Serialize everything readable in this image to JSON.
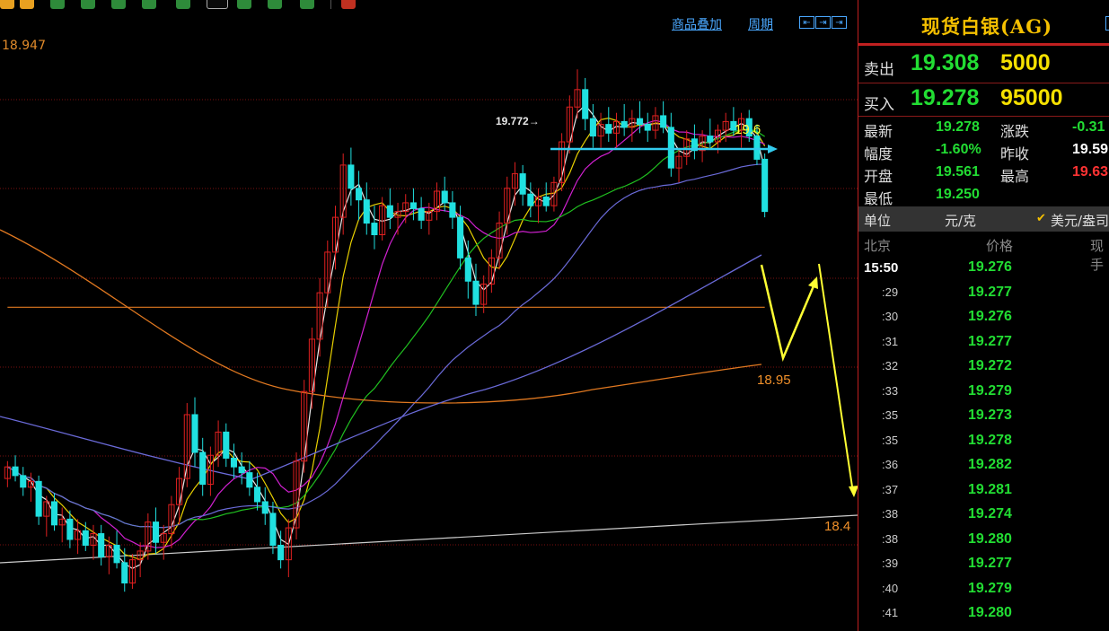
{
  "toolbar": {
    "buttons": [
      {
        "name": "tb-btn-1",
        "style": "orange"
      },
      {
        "name": "tb-btn-2",
        "style": "orange"
      },
      {
        "name": "tb-btn-3",
        "style": "green"
      },
      {
        "name": "tb-btn-4",
        "style": "green"
      },
      {
        "name": "tb-btn-5",
        "style": "green"
      },
      {
        "name": "tb-btn-6",
        "style": "green"
      },
      {
        "name": "tb-btn-7",
        "style": "green"
      },
      {
        "name": "tb-btn-8",
        "style": "sel"
      },
      {
        "name": "tb-btn-9",
        "style": "green"
      },
      {
        "name": "tb-btn-10",
        "style": "green"
      },
      {
        "name": "tb-btn-11",
        "style": "green"
      },
      {
        "name": "tb-btn-12",
        "style": "red"
      }
    ]
  },
  "chart": {
    "menu_overlay": "商品叠加",
    "menu_period": "周期",
    "top_price_label": "18.947",
    "colors": {
      "up": "#e02020",
      "down": "#20e0e0",
      "ma_white": "#e8e8e8",
      "ma_yellow": "#e8d000",
      "ma_magenta": "#d020d0",
      "ma_green": "#20c020",
      "ma_blue": "#6a6ad8",
      "ma_orange": "#e07820",
      "grid": "#7a1010",
      "annotation_yellow": "#ffff33",
      "annotation_cyan": "#33ccee",
      "trendline": "#cccccc",
      "label_orange": "#f0902a"
    }
  },
  "chart_data": {
    "type": "candlestick",
    "instrument": "AG",
    "y_unit": "元/克",
    "high_marker": 19.772,
    "candles_note": "approximate 1-minute candles read from chart",
    "ohlc": [
      [
        18.36,
        18.42,
        18.33,
        18.4
      ],
      [
        18.4,
        18.44,
        18.35,
        18.37
      ],
      [
        18.37,
        18.4,
        18.3,
        18.33
      ],
      [
        18.33,
        18.38,
        18.28,
        18.35
      ],
      [
        18.35,
        18.37,
        18.2,
        18.23
      ],
      [
        18.23,
        18.3,
        18.16,
        18.28
      ],
      [
        18.28,
        18.31,
        18.18,
        18.2
      ],
      [
        18.2,
        18.26,
        18.14,
        18.22
      ],
      [
        18.22,
        18.25,
        18.12,
        18.15
      ],
      [
        18.15,
        18.22,
        18.1,
        18.18
      ],
      [
        18.18,
        18.21,
        18.11,
        18.13
      ],
      [
        18.13,
        18.2,
        18.08,
        18.17
      ],
      [
        18.17,
        18.2,
        18.06,
        18.09
      ],
      [
        18.09,
        18.16,
        18.03,
        18.13
      ],
      [
        18.13,
        18.18,
        18.05,
        18.07
      ],
      [
        18.07,
        18.12,
        17.97,
        18.0
      ],
      [
        18.0,
        18.1,
        17.98,
        18.08
      ],
      [
        18.08,
        18.14,
        18.02,
        18.11
      ],
      [
        18.11,
        18.24,
        18.08,
        18.21
      ],
      [
        18.21,
        18.26,
        18.1,
        18.14
      ],
      [
        18.14,
        18.2,
        18.08,
        18.17
      ],
      [
        18.17,
        18.3,
        18.12,
        18.27
      ],
      [
        18.27,
        18.4,
        18.2,
        18.36
      ],
      [
        18.36,
        18.62,
        18.33,
        18.58
      ],
      [
        18.58,
        18.64,
        18.4,
        18.45
      ],
      [
        18.45,
        18.5,
        18.3,
        18.34
      ],
      [
        18.34,
        18.47,
        18.3,
        18.44
      ],
      [
        18.44,
        18.56,
        18.4,
        18.52
      ],
      [
        18.52,
        18.55,
        18.4,
        18.43
      ],
      [
        18.43,
        18.48,
        18.36,
        18.4
      ],
      [
        18.4,
        18.45,
        18.34,
        18.38
      ],
      [
        18.38,
        18.42,
        18.3,
        18.33
      ],
      [
        18.33,
        18.38,
        18.25,
        18.28
      ],
      [
        18.28,
        18.33,
        18.2,
        18.24
      ],
      [
        18.24,
        18.28,
        18.1,
        18.13
      ],
      [
        18.13,
        18.18,
        18.05,
        18.08
      ],
      [
        18.08,
        18.22,
        18.02,
        18.19
      ],
      [
        18.19,
        18.45,
        18.15,
        18.42
      ],
      [
        18.42,
        18.7,
        18.38,
        18.66
      ],
      [
        18.66,
        18.88,
        18.6,
        18.84
      ],
      [
        18.84,
        19.05,
        18.78,
        19.0
      ],
      [
        19.0,
        19.18,
        18.95,
        19.14
      ],
      [
        19.14,
        19.3,
        19.08,
        19.26
      ],
      [
        19.26,
        19.48,
        19.2,
        19.44
      ],
      [
        19.44,
        19.5,
        19.3,
        19.36
      ],
      [
        19.36,
        19.42,
        19.25,
        19.32
      ],
      [
        19.32,
        19.38,
        19.2,
        19.24
      ],
      [
        19.24,
        19.3,
        19.15,
        19.2
      ],
      [
        19.2,
        19.33,
        19.18,
        19.3
      ],
      [
        19.3,
        19.36,
        19.22,
        19.26
      ],
      [
        19.26,
        19.31,
        19.2,
        19.28
      ],
      [
        19.28,
        19.34,
        19.24,
        19.31
      ],
      [
        19.31,
        19.36,
        19.25,
        19.29
      ],
      [
        19.29,
        19.33,
        19.22,
        19.25
      ],
      [
        19.25,
        19.31,
        19.2,
        19.28
      ],
      [
        19.28,
        19.38,
        19.25,
        19.35
      ],
      [
        19.35,
        19.4,
        19.28,
        19.31
      ],
      [
        19.31,
        19.35,
        19.22,
        19.26
      ],
      [
        19.26,
        19.3,
        19.08,
        19.12
      ],
      [
        19.12,
        19.18,
        18.98,
        19.04
      ],
      [
        19.04,
        19.1,
        18.92,
        18.96
      ],
      [
        18.96,
        19.06,
        18.93,
        19.03
      ],
      [
        19.03,
        19.15,
        19.0,
        19.12
      ],
      [
        19.12,
        19.28,
        19.08,
        19.24
      ],
      [
        19.24,
        19.4,
        19.2,
        19.36
      ],
      [
        19.36,
        19.45,
        19.3,
        19.41
      ],
      [
        19.41,
        19.44,
        19.3,
        19.34
      ],
      [
        19.34,
        19.38,
        19.26,
        19.3
      ],
      [
        19.3,
        19.36,
        19.24,
        19.33
      ],
      [
        19.33,
        19.38,
        19.28,
        19.3
      ],
      [
        19.3,
        19.4,
        19.28,
        19.38
      ],
      [
        19.38,
        19.55,
        19.35,
        19.52
      ],
      [
        19.52,
        19.68,
        19.48,
        19.64
      ],
      [
        19.64,
        19.77,
        19.6,
        19.7
      ],
      [
        19.7,
        19.74,
        19.56,
        19.6
      ],
      [
        19.6,
        19.65,
        19.5,
        19.54
      ],
      [
        19.54,
        19.62,
        19.5,
        19.58
      ],
      [
        19.58,
        19.64,
        19.52,
        19.55
      ],
      [
        19.55,
        19.62,
        19.5,
        19.59
      ],
      [
        19.59,
        19.65,
        19.54,
        19.57
      ],
      [
        19.57,
        19.63,
        19.52,
        19.6
      ],
      [
        19.6,
        19.66,
        19.55,
        19.58
      ],
      [
        19.58,
        19.62,
        19.52,
        19.56
      ],
      [
        19.56,
        19.64,
        19.53,
        19.61
      ],
      [
        19.61,
        19.66,
        19.55,
        19.57
      ],
      [
        19.57,
        19.62,
        19.4,
        19.43
      ],
      [
        19.43,
        19.5,
        19.38,
        19.47
      ],
      [
        19.47,
        19.56,
        19.44,
        19.53
      ],
      [
        19.53,
        19.58,
        19.46,
        19.49
      ],
      [
        19.49,
        19.56,
        19.45,
        19.54
      ],
      [
        19.54,
        19.6,
        19.5,
        19.52
      ],
      [
        19.52,
        19.58,
        19.48,
        19.56
      ],
      [
        19.56,
        19.62,
        19.52,
        19.59
      ],
      [
        19.59,
        19.64,
        19.54,
        19.56
      ],
      [
        19.56,
        19.62,
        19.5,
        19.6
      ],
      [
        19.6,
        19.63,
        19.52,
        19.54
      ],
      [
        19.54,
        19.58,
        19.44,
        19.46
      ],
      [
        19.46,
        19.48,
        19.26,
        19.28
      ]
    ],
    "moving_averages": [
      {
        "color": "ma_white",
        "name": "MA5"
      },
      {
        "color": "ma_yellow",
        "name": "MA10"
      },
      {
        "color": "ma_magenta",
        "name": "MA20"
      },
      {
        "color": "ma_green",
        "name": "MA40"
      },
      {
        "color": "ma_blue",
        "name": "MA60"
      },
      {
        "color": "ma_orange",
        "name": "MA120"
      }
    ],
    "annotations": [
      {
        "text": "19.772",
        "kind": "high_label"
      },
      {
        "text": "19.6",
        "kind": "resistance_label"
      },
      {
        "text": "18.95",
        "kind": "target_label"
      },
      {
        "text": "18.4",
        "kind": "target_label"
      }
    ],
    "y_range": [
      17.85,
      19.95
    ]
  },
  "sidebar": {
    "title": "现货白银(AG)",
    "sell_label": "卖出",
    "sell_price": "19.308",
    "sell_volume": "5000",
    "buy_label": "买入",
    "buy_price": "19.278",
    "buy_volume": "95000",
    "stats": [
      {
        "k": "最新",
        "v": "19.278",
        "vcolor": "#22dd33",
        "k2": "涨跌",
        "v2": "-0.31",
        "v2color": "#22dd33"
      },
      {
        "k": "幅度",
        "v": "-1.60%",
        "vcolor": "#22dd33",
        "k2": "昨收",
        "v2": "19.59",
        "v2color": "#ffffff"
      },
      {
        "k": "开盘",
        "v": "19.561",
        "vcolor": "#22dd33",
        "k2": "最高",
        "v2": "19.63",
        "v2color": "#ff3333"
      },
      {
        "k": "最低",
        "v": "19.250",
        "vcolor": "#22dd33",
        "k2": "",
        "v2": "",
        "v2color": "#ffffff"
      }
    ],
    "unit_label": "单位",
    "unit_value": "元/克",
    "unit_check": "✔",
    "unit_right": "美元/盎司",
    "ticks_header_time": "北京",
    "ticks_header_price": "价格",
    "ticks_header_vol": "现手",
    "ticks": [
      {
        "t": "15:50",
        "p": "19.276"
      },
      {
        "t": ":29",
        "p": "19.277"
      },
      {
        "t": ":30",
        "p": "19.276"
      },
      {
        "t": ":31",
        "p": "19.277"
      },
      {
        "t": ":32",
        "p": "19.272"
      },
      {
        "t": ":33",
        "p": "19.279"
      },
      {
        "t": ":35",
        "p": "19.273"
      },
      {
        "t": ":35",
        "p": "19.278"
      },
      {
        "t": ":36",
        "p": "19.282"
      },
      {
        "t": ":37",
        "p": "19.281"
      },
      {
        "t": ":38",
        "p": "19.274"
      },
      {
        "t": ":38",
        "p": "19.280"
      },
      {
        "t": ":39",
        "p": "19.277"
      },
      {
        "t": ":40",
        "p": "19.279"
      },
      {
        "t": ":41",
        "p": "19.280"
      }
    ]
  }
}
